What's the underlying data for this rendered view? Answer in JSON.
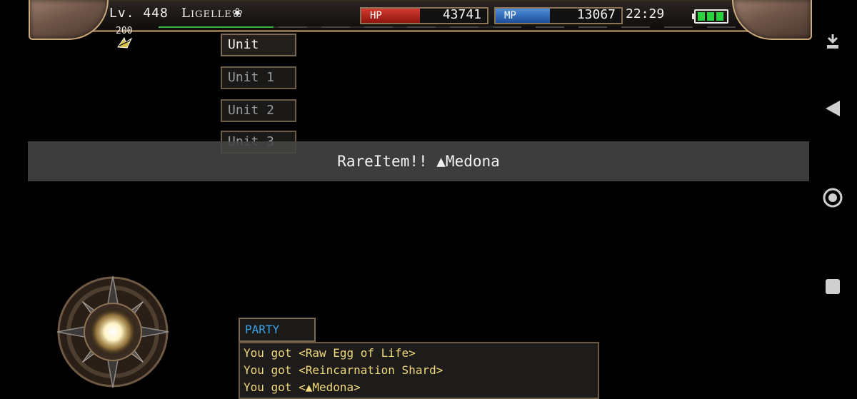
{
  "hud": {
    "level": "Lv. 448",
    "player_name": "Ligelle❀",
    "hp_label": "HP",
    "hp_value": "43741",
    "mp_label": "MP",
    "mp_value": "13067",
    "time": "22:29",
    "buff_count": "200",
    "battery_icon": "battery-icon",
    "colors": {
      "hp": "#d43a2e",
      "mp": "#4f8fd8",
      "battery": "#2bd23d"
    }
  },
  "unit_menu": {
    "header": "Unit",
    "items": [
      "Unit 1",
      "Unit 2",
      "Unit 3"
    ]
  },
  "banner": {
    "text": "RareItem!! ▲Medona"
  },
  "chat": {
    "tab_label": "PARTY",
    "tab_color": "#3aa2e8",
    "text_color": "#f1d97b",
    "lines": [
      "You got <Raw Egg of Life>",
      "You got <Reincarnation Shard>",
      "You got <▲Medona>"
    ]
  },
  "system_nav": {
    "icons": [
      "download-icon",
      "back-icon",
      "home-icon",
      "recents-icon"
    ]
  }
}
